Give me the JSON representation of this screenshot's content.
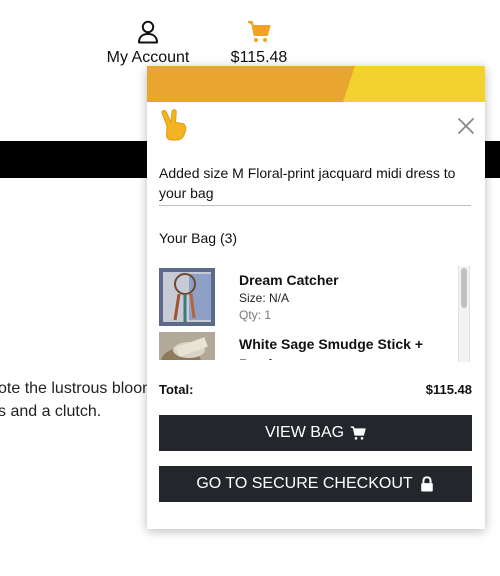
{
  "header": {
    "account_label": "My Account",
    "cart_total": "$115.48",
    "accent_color": "#f2a324"
  },
  "background": {
    "line1": "ote the lustrous bloom",
    "line2": "s and a clutch."
  },
  "popup": {
    "banner_colors": [
      "#e8a631",
      "#f3d22f"
    ],
    "added_message": "Added size M Floral-print jacquard midi dress to your bag",
    "bag_title": "Your Bag (3)",
    "items": [
      {
        "name": "Dream Catcher",
        "size": "Size: N/A",
        "qty": "Qty: 1"
      },
      {
        "name": "White Sage Smudge Stick + Bowl",
        "size": "",
        "qty": ""
      }
    ],
    "total_label": "Total:",
    "total_value": "$115.48",
    "view_bag_label": "VIEW BAG",
    "checkout_label": "GO TO SECURE CHECKOUT",
    "button_color": "#23262b",
    "icons": [
      "hand-icon",
      "close-icon",
      "cart-icon",
      "lock-icon",
      "user-icon"
    ]
  }
}
